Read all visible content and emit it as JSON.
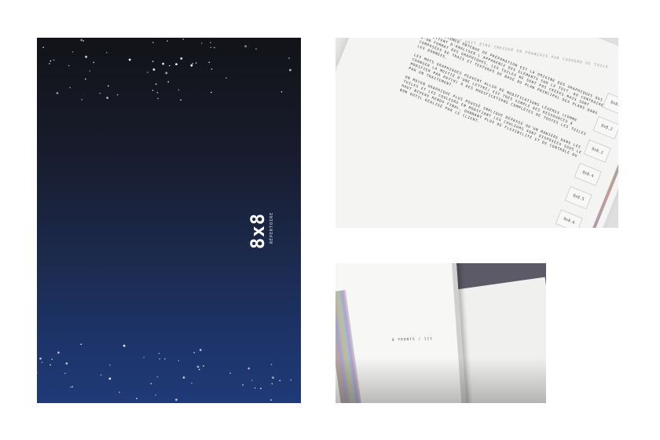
{
  "cover": {
    "logo_text": "8x8",
    "subtitle": "RÉPERTOIRE",
    "colors": {
      "top": "#121318",
      "bottom": "#1f3a78",
      "stars": "#ffffff"
    }
  },
  "photo_top": {
    "header": "TOUT DOIT ÊTRE INDIQUÉ EN FRANÇAIS PAR CADREMO DE TOILE",
    "paragraphs": [
      "UNE COMPÉTENCE OBTENUE DE PRÉPARATION EST LA ORIGINE DES GRAPHIQUES QUI PERMETTENT D'ANALYSER L'APPARENCE DES ÉLÉMENTS SUR LE TOIT. AU CONTRAIRE D'UN FORMAT DES GRAPHIQUES, LES TUILES NE SONT PAS CRÉÉES MAIS SONT COMPOSÉES DE TRAIS ET TEXTURES DE BASE DU PLAN PRINCIPAL DES PLANS DANS LES DONNÉES.",
      "LES MOTS GRAPHIQUES PEUVENT ALLER DE MODIFICATIONS LÉGÈRES (COMME CHANGER LA MOITIÉ D'UNE LETTRE) EST TRÈS SIMPLE DES RESSOURCES À MODIFIER PAR PATCH) À DES MODIFICATIONS COMPLÈTES DE TOUTES LES TUILES PAR UN TRAITEMENT.",
      "UN MOYEN GRAPHIQUE PLUS POUSSÉ IMPLIQUE DÉPASSE QU'UN MANIÈRE DANS LES TUILES ET LES COULEURS EN MODIFIANT LES COULEURS SONT DISPOSÉES SOUS LE HAUT NIVEAU RENDU FINAL, DONNANT PLUS DE FLEXIBILITÉ ET DE CONTRÔLE DU BON OUTIL RÉALISÉ PAR LE CLIENT."
    ],
    "tabs": [
      "8x8.1",
      "8x8.2",
      "8x8.3",
      "8x8.4",
      "8x8.5",
      "8x8.6"
    ]
  },
  "photo_bottom": {
    "caption": "8 FRONTS / 111"
  }
}
